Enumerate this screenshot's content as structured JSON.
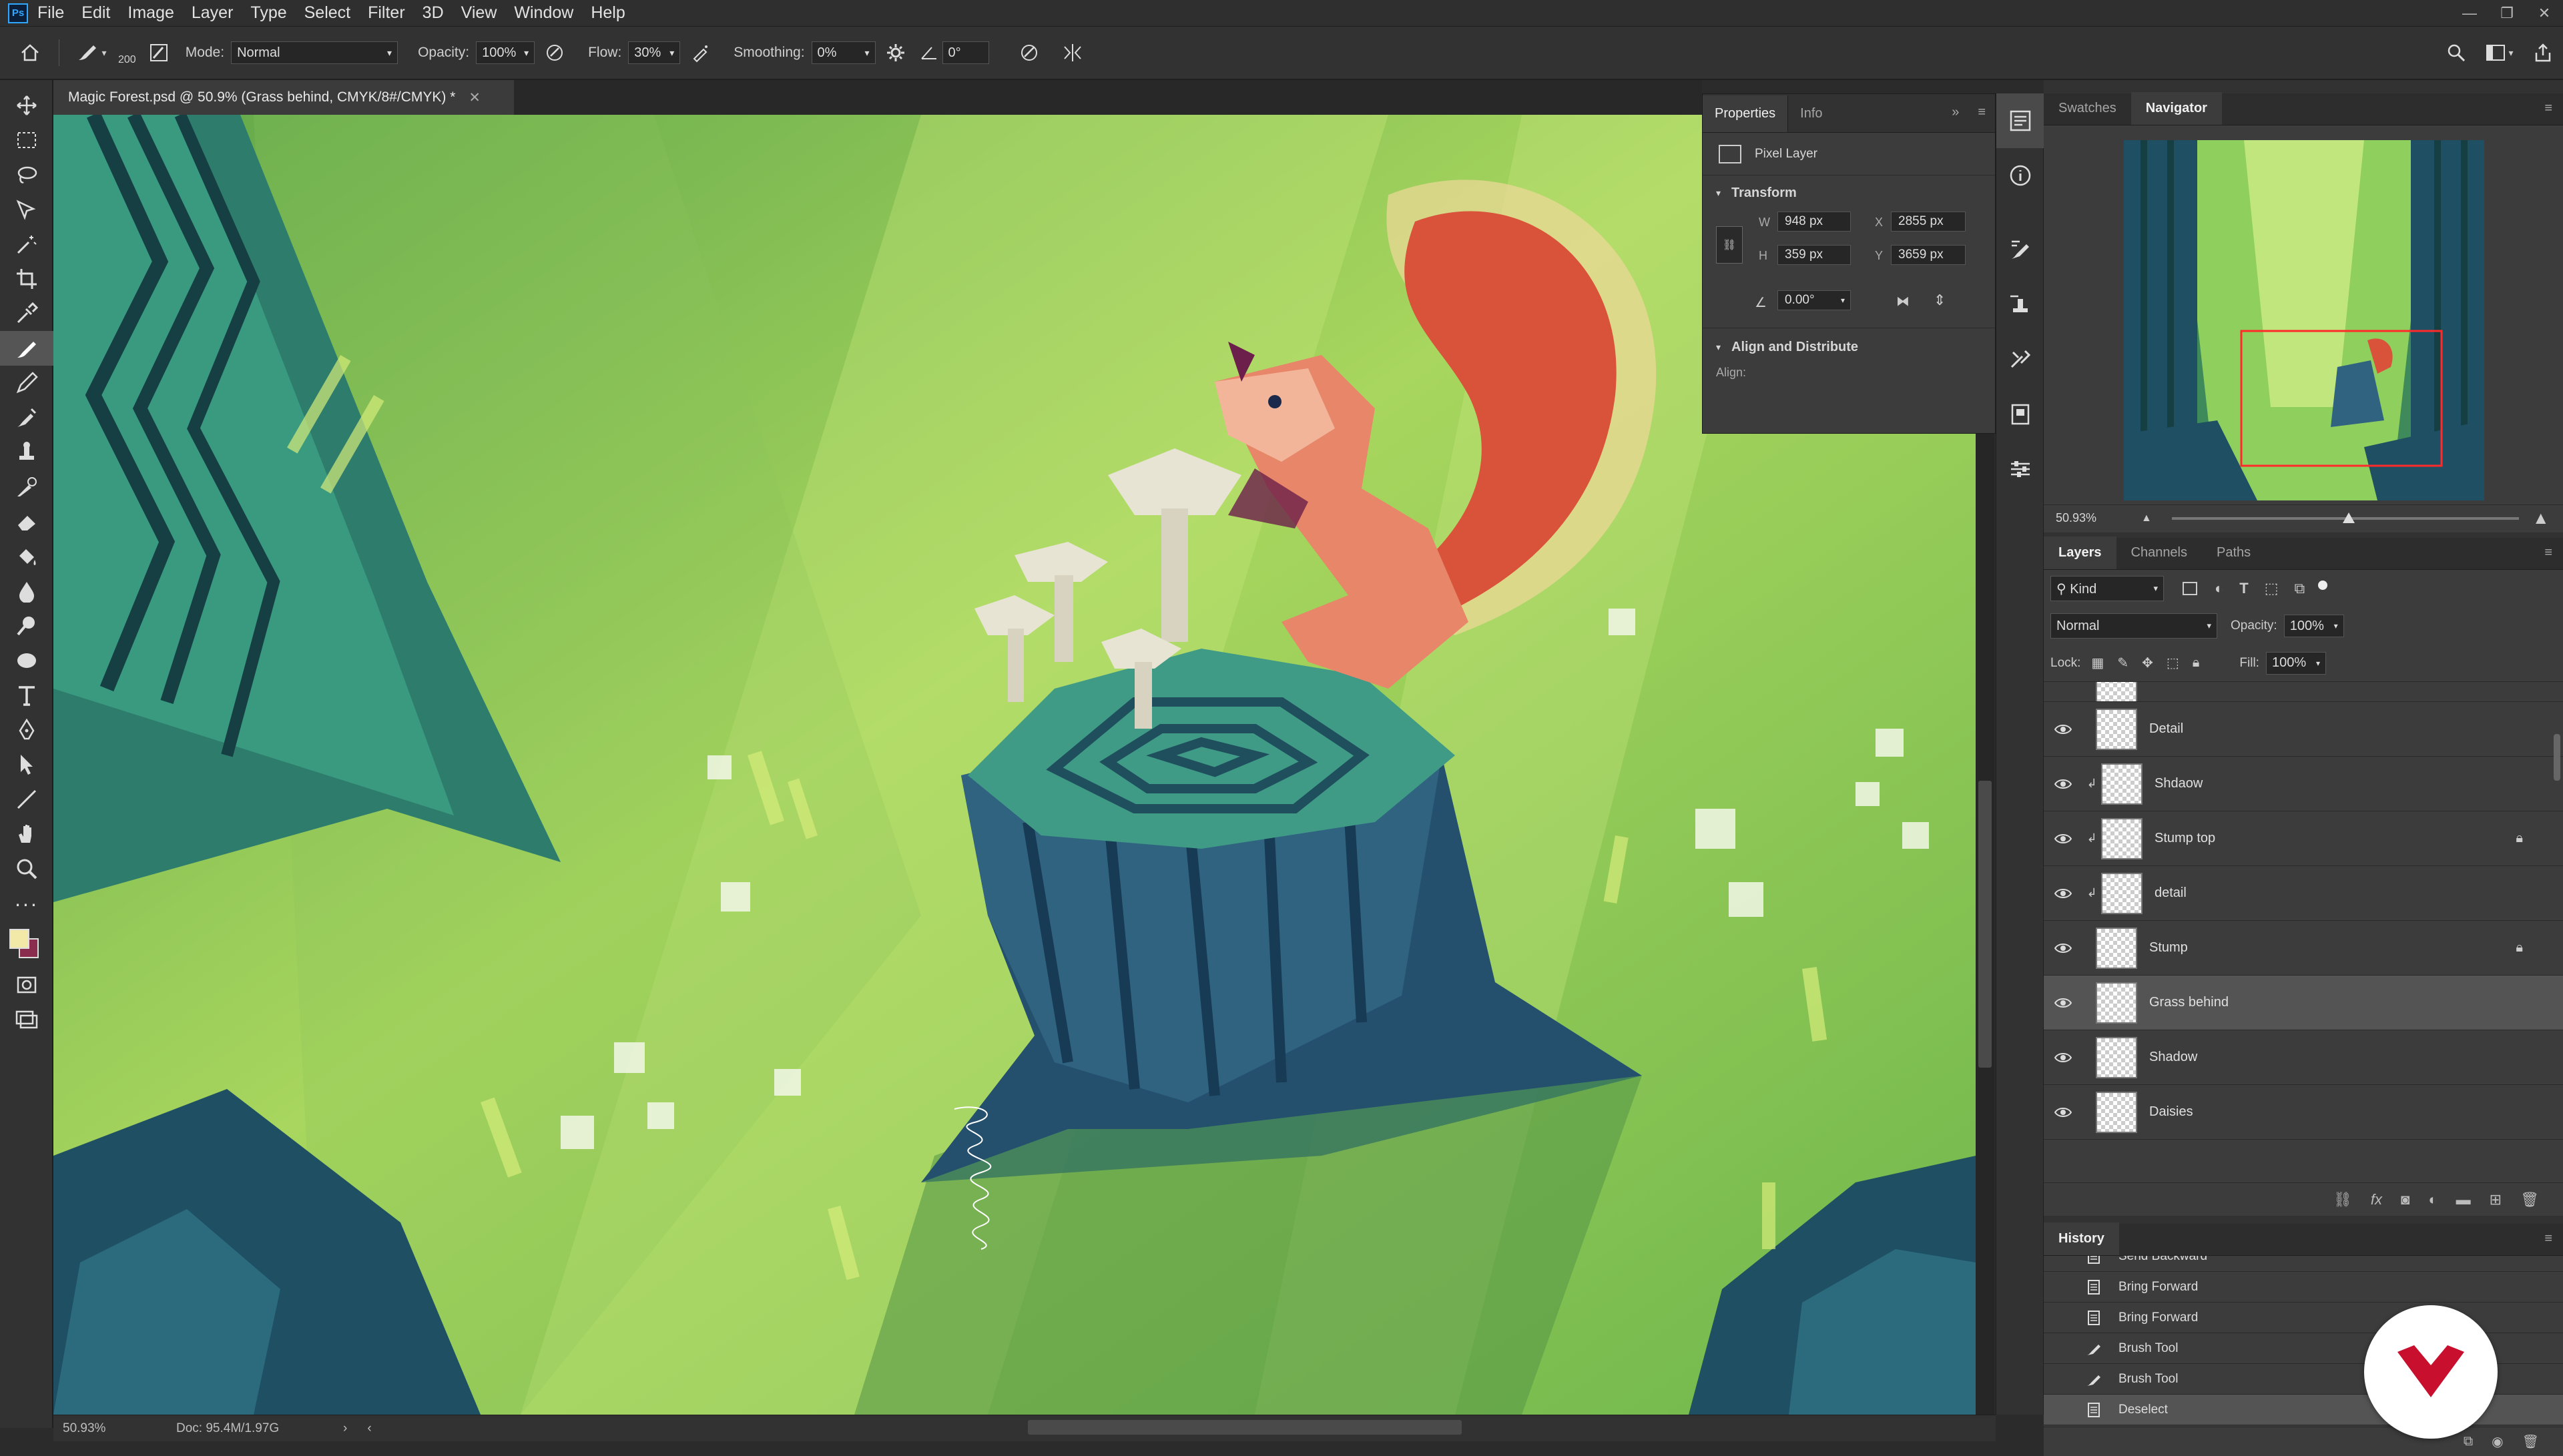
{
  "app": {
    "logo": "Ps",
    "menu": [
      "File",
      "Edit",
      "Image",
      "Layer",
      "Type",
      "Select",
      "Filter",
      "3D",
      "View",
      "Window",
      "Help"
    ]
  },
  "options": {
    "brush_size": "200",
    "mode_label": "Mode:",
    "mode_value": "Normal",
    "opacity_label": "Opacity:",
    "opacity_value": "100%",
    "flow_label": "Flow:",
    "flow_value": "30%",
    "smoothing_label": "Smoothing:",
    "smoothing_value": "0%",
    "angle_value": "0°"
  },
  "document": {
    "tab_title": "Magic Forest.psd @ 50.9% (Grass behind, CMYK/8#/CMYK) *"
  },
  "status": {
    "zoom": "50.93%",
    "doc": "Doc: 95.4M/1.97G"
  },
  "properties": {
    "tabs": [
      "Properties",
      "Info"
    ],
    "layer_type": "Pixel Layer",
    "transform_title": "Transform",
    "w_label": "W",
    "w_value": "948 px",
    "h_label": "H",
    "h_value": "359 px",
    "x_label": "X",
    "x_value": "2855 px",
    "y_label": "Y",
    "y_value": "3659 px",
    "angle_value": "0.00°",
    "align_title": "Align and Distribute",
    "align_label": "Align:"
  },
  "navigator": {
    "tabs": [
      "Swatches",
      "Navigator"
    ],
    "zoom": "50.93%"
  },
  "layers_panel": {
    "tabs": [
      "Layers",
      "Channels",
      "Paths"
    ],
    "filter_kind": "Kind",
    "blend_mode": "Normal",
    "opacity_label": "Opacity:",
    "opacity_value": "100%",
    "lock_label": "Lock:",
    "fill_label": "Fill:",
    "fill_value": "100%",
    "layers": [
      {
        "name": "Detail",
        "clip": false,
        "locked": false,
        "selected": false
      },
      {
        "name": "Shdaow",
        "clip": true,
        "locked": false,
        "selected": false
      },
      {
        "name": "Stump top",
        "clip": true,
        "locked": true,
        "selected": false
      },
      {
        "name": "detail",
        "clip": true,
        "locked": false,
        "selected": false
      },
      {
        "name": "Stump",
        "clip": false,
        "locked": true,
        "selected": false
      },
      {
        "name": "Grass behind",
        "clip": false,
        "locked": false,
        "selected": true
      },
      {
        "name": "Shadow",
        "clip": false,
        "locked": false,
        "selected": false
      },
      {
        "name": "Daisies",
        "clip": false,
        "locked": false,
        "selected": false
      }
    ]
  },
  "history": {
    "title": "History",
    "items": [
      {
        "label": "Send Backward",
        "icon": "doc-icon"
      },
      {
        "label": "Bring Forward",
        "icon": "doc-icon"
      },
      {
        "label": "Bring Forward",
        "icon": "doc-icon"
      },
      {
        "label": "Brush Tool",
        "icon": "brush-icon"
      },
      {
        "label": "Brush Tool",
        "icon": "brush-icon"
      },
      {
        "label": "Deselect",
        "icon": "doc-icon",
        "selected": true
      }
    ]
  },
  "colors": {
    "foreground": "#f2e8a8",
    "background": "#8a2c4e",
    "accent": "#31a8ff",
    "watermark": "#c8102e"
  }
}
